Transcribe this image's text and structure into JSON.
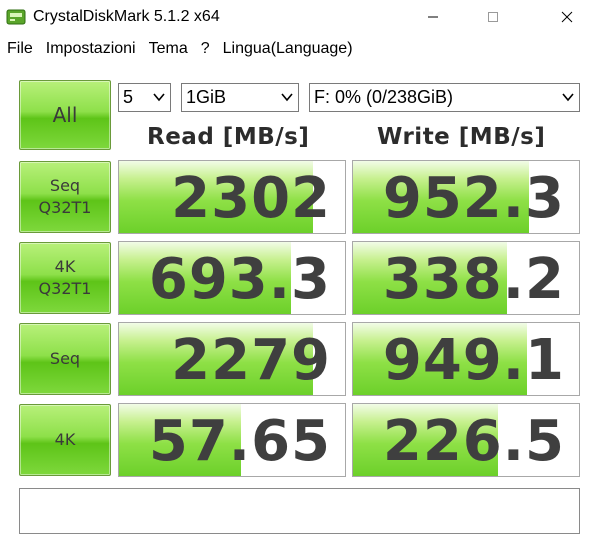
{
  "window": {
    "title": "CrystalDiskMark 5.1.2 x64",
    "icon": "app-disk-icon",
    "controls": [
      "minimize-icon",
      "maximize-icon",
      "close-icon"
    ]
  },
  "menu": {
    "items": [
      "File",
      "Impostazioni",
      "Tema",
      "?",
      "Lingua(Language)"
    ]
  },
  "toolbar": {
    "all_label": "All",
    "count_value": "5",
    "size_value": "1GiB",
    "drive_value": "F: 0% (0/238GiB)"
  },
  "headers": {
    "read": "Read [MB/s]",
    "write": "Write [MB/s]"
  },
  "tests": [
    {
      "line1": "Seq",
      "line2": "Q32T1",
      "read": "2302",
      "write": "952.3",
      "read_fill": 0.86,
      "write_fill": 0.78
    },
    {
      "line1": "4K",
      "line2": "Q32T1",
      "read": "693.3",
      "write": "338.2",
      "read_fill": 0.76,
      "write_fill": 0.68
    },
    {
      "line1": "Seq",
      "line2": "",
      "read": "2279",
      "write": "949.1",
      "read_fill": 0.86,
      "write_fill": 0.77
    },
    {
      "line1": "4K",
      "line2": "",
      "read": "57.65",
      "write": "226.5",
      "read_fill": 0.54,
      "write_fill": 0.64
    }
  ],
  "status_text": "",
  "colors": {
    "button_green": "#7ed83c",
    "bar_green": "#8ee046",
    "value_text": "#3f3f3f"
  }
}
